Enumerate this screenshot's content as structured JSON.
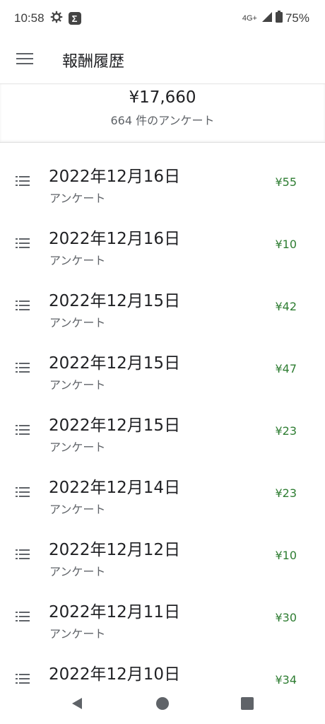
{
  "status": {
    "time": "10:58",
    "network": "4G+",
    "battery": "75%"
  },
  "app_bar": {
    "title": "報酬履歴"
  },
  "summary": {
    "total": "¥17,660",
    "count": "664 件のアンケート"
  },
  "items": [
    {
      "date": "2022年12月16日",
      "type": "アンケート",
      "amount": "¥55"
    },
    {
      "date": "2022年12月16日",
      "type": "アンケート",
      "amount": "¥10"
    },
    {
      "date": "2022年12月15日",
      "type": "アンケート",
      "amount": "¥42"
    },
    {
      "date": "2022年12月15日",
      "type": "アンケート",
      "amount": "¥47"
    },
    {
      "date": "2022年12月15日",
      "type": "アンケート",
      "amount": "¥23"
    },
    {
      "date": "2022年12月14日",
      "type": "アンケート",
      "amount": "¥23"
    },
    {
      "date": "2022年12月12日",
      "type": "アンケート",
      "amount": "¥10"
    },
    {
      "date": "2022年12月11日",
      "type": "アンケート",
      "amount": "¥30"
    },
    {
      "date": "2022年12月10日",
      "type": "",
      "amount": "¥34"
    }
  ],
  "colors": {
    "amount": "#2e7d32",
    "text": "#202124",
    "secondary": "#5f6368"
  },
  "icons": {
    "menu": "menu-icon",
    "list": "list-icon",
    "back": "back-icon",
    "home": "home-icon",
    "recents": "recents-icon"
  }
}
